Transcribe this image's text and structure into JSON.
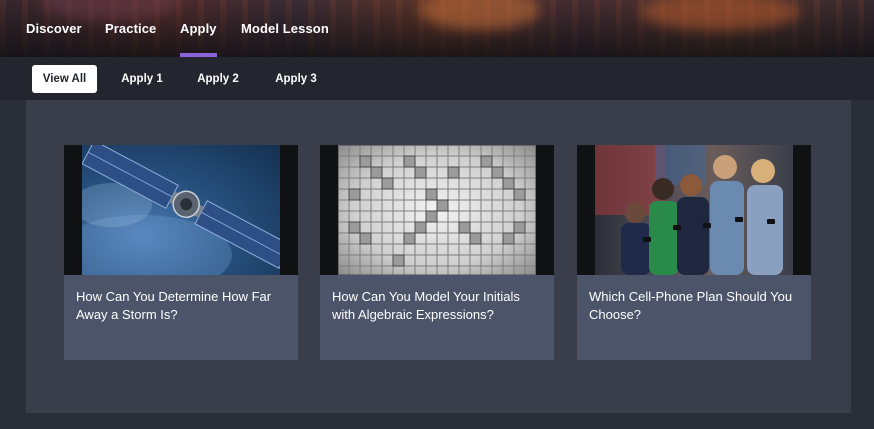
{
  "nav": {
    "items": [
      {
        "label": "Discover",
        "active": false
      },
      {
        "label": "Practice",
        "active": false
      },
      {
        "label": "Apply",
        "active": true
      },
      {
        "label": "Model Lesson",
        "active": false
      }
    ],
    "accent_color": "#8a63d8"
  },
  "subtabs": {
    "items": [
      {
        "label": "View All",
        "active": true
      },
      {
        "label": "Apply 1",
        "active": false
      },
      {
        "label": "Apply 2",
        "active": false
      },
      {
        "label": "Apply 3",
        "active": false
      }
    ]
  },
  "cards": [
    {
      "title": "How Can You Determine How Far Away a Storm Is?",
      "image": "satellite-over-earth"
    },
    {
      "title": "How Can You Model Your Initials with Algebraic Expressions?",
      "image": "grid-with-letter-pattern"
    },
    {
      "title": "Which Cell-Phone Plan Should You Choose?",
      "image": "people-using-phones"
    }
  ]
}
